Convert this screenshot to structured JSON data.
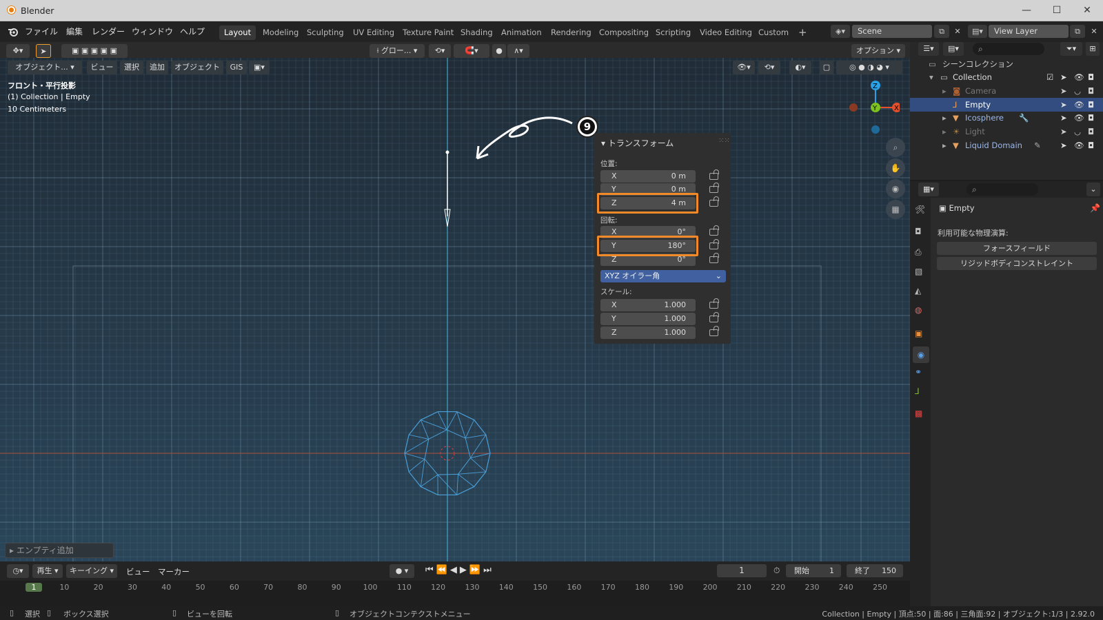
{
  "window": {
    "title": "Blender",
    "controls": [
      "—",
      "☐",
      "✕"
    ]
  },
  "menus": [
    "ファイル",
    "編集",
    "レンダー",
    "ウィンドウ",
    "ヘルプ"
  ],
  "workspaces": [
    "Layout",
    "Modeling",
    "Sculpting",
    "UV Editing",
    "Texture Paint",
    "Shading",
    "Animation",
    "Rendering",
    "Compositing",
    "Scripting",
    "Video Editing",
    "Custom"
  ],
  "scene": "Scene",
  "view_layer": "View Layer",
  "toolbar": {
    "transform_orient": "グロー...",
    "options": "オプション"
  },
  "viewport_header": {
    "mode": "オブジェクト...",
    "view": "ビュー",
    "select": "選択",
    "add": "追加",
    "object": "オブジェクト",
    "gis": "GIS"
  },
  "overlay": {
    "line1": "フロント・平行投影",
    "line2": "(1) Collection | Empty",
    "line3": "10 Centimeters"
  },
  "annotation": "9",
  "transform": {
    "title": "トランスフォーム",
    "location_label": "位置:",
    "location": [
      {
        "axis": "X",
        "value": "0 m"
      },
      {
        "axis": "Y",
        "value": "0 m"
      },
      {
        "axis": "Z",
        "value": "4 m"
      }
    ],
    "rotation_label": "回転:",
    "rotation": [
      {
        "axis": "X",
        "value": "0°"
      },
      {
        "axis": "Y",
        "value": "180°"
      },
      {
        "axis": "Z",
        "value": "0°"
      }
    ],
    "euler_mode": "XYZ オイラー角",
    "scale_label": "スケール:",
    "scale": [
      {
        "axis": "X",
        "value": "1.000"
      },
      {
        "axis": "Y",
        "value": "1.000"
      },
      {
        "axis": "Z",
        "value": "1.000"
      }
    ]
  },
  "last_op": "エンプティ追加",
  "outliner": {
    "root": "シーンコレクション",
    "collection": "Collection",
    "items": [
      {
        "name": "Camera",
        "dim": true
      },
      {
        "name": "Empty",
        "selected": true
      },
      {
        "name": "Icosphere"
      },
      {
        "name": "Light",
        "dim": true
      },
      {
        "name": "Liquid Domain"
      }
    ]
  },
  "properties": {
    "object": "Empty",
    "physics_label": "利用可能な物理演算:",
    "btn_forcefield": "フォースフィールド",
    "btn_rigidbody": "リジッドボディコンストレイント"
  },
  "timeline": {
    "play": "再生",
    "keying": "キーイング",
    "view": "ビュー",
    "marker": "マーカー",
    "current": "1",
    "start_label": "開始",
    "start": "1",
    "end_label": "終了",
    "end": "150",
    "ticks": [
      "1",
      "10",
      "20",
      "30",
      "40",
      "50",
      "60",
      "70",
      "80",
      "90",
      "100",
      "110",
      "120",
      "130",
      "140",
      "150",
      "160",
      "170",
      "180",
      "190",
      "200",
      "210",
      "220",
      "230",
      "240",
      "250"
    ]
  },
  "status": {
    "select": "選択",
    "box": "ボックス選択",
    "rotate": "ビューを回転",
    "ctx": "オブジェクトコンテクストメニュー",
    "stats": "Collection | Empty | 頂点:50 | 面:86 | 三角面:92 | オブジェクト:1/3 | 2.92.0"
  },
  "colors": {
    "highlight": "#f28a2a",
    "selected_row": "#334d80",
    "axis_x": "#e3502b",
    "axis_y": "#7cc120",
    "axis_z": "#2aa1e6"
  }
}
